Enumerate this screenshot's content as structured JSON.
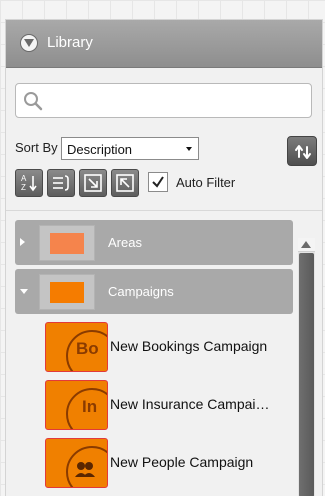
{
  "library": {
    "title": "Library",
    "search": {
      "placeholder": "",
      "value": ""
    },
    "sort": {
      "label": "Sort By",
      "selected": "Description"
    },
    "auto_filter": {
      "label": "Auto Filter",
      "checked": true
    },
    "toolbar_icons": [
      "sort-az-icon",
      "list-icon",
      "expand-icon",
      "collapse-icon"
    ],
    "groups": [
      {
        "label": "Areas",
        "expanded": false,
        "color": "#f5844c"
      },
      {
        "label": "Campaigns",
        "expanded": true,
        "color": "#f57c00"
      }
    ],
    "items": [
      {
        "label": "New Bookings Campaign",
        "abbr": "Bo"
      },
      {
        "label": "New Insurance Campai…",
        "abbr": "In"
      },
      {
        "label": "New People Campaign",
        "abbr": "people-icon"
      }
    ]
  }
}
